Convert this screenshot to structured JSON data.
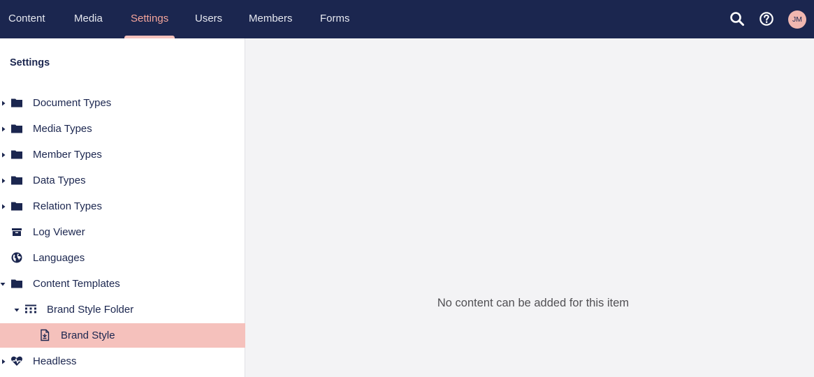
{
  "nav": {
    "tabs": [
      {
        "label": "Content"
      },
      {
        "label": "Media"
      },
      {
        "label": "Settings"
      },
      {
        "label": "Users"
      },
      {
        "label": "Members"
      },
      {
        "label": "Forms"
      }
    ],
    "active_tab": "Settings",
    "search_icon": "search-icon",
    "help_icon": "help-icon",
    "avatar_initials": "JM"
  },
  "sidebar": {
    "title": "Settings",
    "items": [
      {
        "label": "Document Types",
        "icon": "folder-icon",
        "caret": "collapsed"
      },
      {
        "label": "Media Types",
        "icon": "folder-icon",
        "caret": "collapsed"
      },
      {
        "label": "Member Types",
        "icon": "folder-icon",
        "caret": "collapsed"
      },
      {
        "label": "Data Types",
        "icon": "folder-icon",
        "caret": "collapsed"
      },
      {
        "label": "Relation Types",
        "icon": "folder-icon",
        "caret": "collapsed"
      },
      {
        "label": "Log Viewer",
        "icon": "archive-icon",
        "caret": "none"
      },
      {
        "label": "Languages",
        "icon": "globe-icon",
        "caret": "none"
      },
      {
        "label": "Content Templates",
        "icon": "folder-icon",
        "caret": "expanded"
      },
      {
        "label": "Brand Style Folder",
        "icon": "grid-icon",
        "caret": "expanded"
      },
      {
        "label": "Brand Style",
        "icon": "document-icon",
        "caret": "none",
        "selected": true
      },
      {
        "label": "Headless",
        "icon": "heart-icon",
        "caret": "collapsed"
      }
    ]
  },
  "main": {
    "empty_message": "No content can be added for this item"
  },
  "colors": {
    "topbar": "#1b264f",
    "active_tab": "#f5a59b",
    "selected_row": "#f5c1bc",
    "main_bg": "#f3f3f5"
  }
}
